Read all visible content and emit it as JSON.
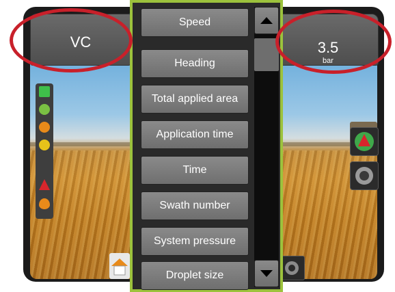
{
  "left_tile": {
    "label": "VC"
  },
  "right_tile": {
    "value": "3.5",
    "unit": "bar"
  },
  "menu": {
    "items": [
      {
        "label": "Speed"
      },
      {
        "label": "Heading"
      },
      {
        "label": "Total applied area"
      },
      {
        "label": "Application time"
      },
      {
        "label": "Time"
      },
      {
        "label": "Swath number"
      },
      {
        "label": "System pressure"
      },
      {
        "label": "Droplet size"
      }
    ],
    "scroll_up_icon": "triangle-up-icon",
    "scroll_down_icon": "triangle-down-icon"
  },
  "colors": {
    "menu_border": "#9cc23c",
    "highlight": "#c8202a"
  },
  "left_sidebar": {
    "icons": [
      "boom-sections-icon",
      "auto-steer-icon",
      "orange-warning-icon",
      "yellow-warning-icon",
      "applicator-icon",
      "product-drop-icon"
    ]
  },
  "right_sidebar": {
    "icons": [
      "guidance-arrow-icon",
      "tyre-icon"
    ]
  },
  "bottom": {
    "icons": [
      "home-icon",
      "camera-icon"
    ]
  }
}
